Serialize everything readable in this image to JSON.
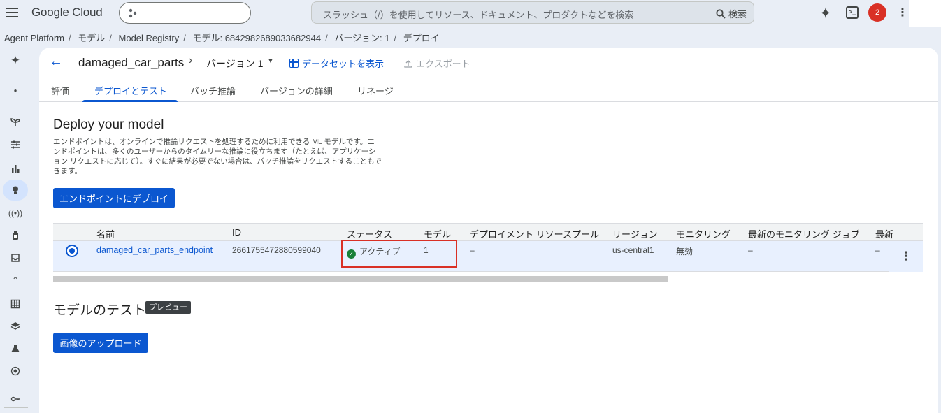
{
  "topbar": {
    "logo": "Google Cloud",
    "search_placeholder": "スラッシュ（/）を使用してリソース、ドキュメント、プロダクトなどを検索",
    "search_button": "検索",
    "notification_count": "2"
  },
  "breadcrumb": {
    "items": [
      "Agent Platform",
      "モデル",
      "Model Registry",
      "モデル: 6842982689033682944",
      "バージョン: 1",
      "デプロイ"
    ]
  },
  "leftnav": {
    "icons": [
      "sparkle-icon",
      "dot-icon",
      "sprout-icon",
      "tune-icon",
      "bar-chart-icon",
      "lightbulb-icon",
      "broadcast-icon",
      "bottle-icon",
      "inbox-icon",
      "chevron-up-icon",
      "table-icon",
      "layers-icon",
      "flask-icon",
      "hub-icon",
      "key-icon"
    ],
    "active_index": 5
  },
  "header": {
    "model_name": "damaged_car_parts",
    "version_label": "バージョン 1",
    "dataset_link": "データセットを表示",
    "export_label": "エクスポート"
  },
  "tabs": [
    "評価",
    "デプロイとテスト",
    "バッチ推論",
    "バージョンの詳細",
    "リネージ"
  ],
  "active_tab": "デプロイとテスト",
  "deploy": {
    "title": "Deploy your model",
    "description": "エンドポイントは、オンラインで推論リクエストを処理するために利用できる ML モデルです。エンドポイントは、多くのユーザーからのタイムリーな推論に役立ちます（たとえば、アプリケーション リクエストに応じて）。すぐに結果が必要でない場合は、バッチ推論をリクエストすることもできます。",
    "button": "エンドポイントにデプロイ"
  },
  "table": {
    "headers": [
      "名前",
      "ID",
      "ステータス",
      "モデル",
      "デプロイメント リソースプール",
      "リージョン",
      "モニタリング",
      "最新のモニタリング ジョブ",
      "最新"
    ],
    "row": {
      "name": "damaged_car_parts_endpoint",
      "id": "2661755472880599040",
      "status": "アクティブ",
      "models": "1",
      "resource_pool": "–",
      "region": "us-central1",
      "monitoring": "無効",
      "latest_job": "–",
      "latest": "–"
    }
  },
  "test": {
    "title": "モデルのテスト",
    "badge": "プレビュー",
    "upload_button": "画像のアップロード"
  },
  "colors": {
    "accent": "#0b57d0",
    "status_ok": "#188038",
    "highlight": "#d93025"
  }
}
